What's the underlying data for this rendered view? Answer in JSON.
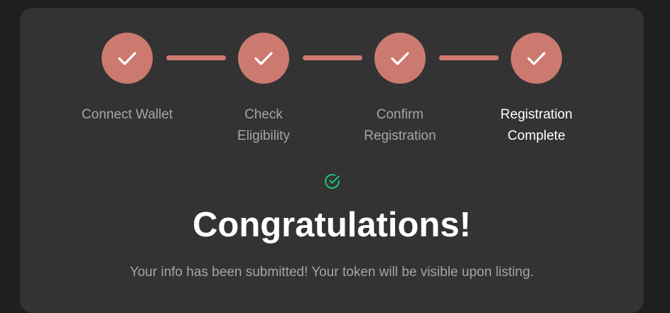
{
  "colors": {
    "page_background": "#1f1f1f",
    "card_background": "#333333",
    "step_complete": "#cc7a6f",
    "success_green": "#1fbf73",
    "text_muted": "#a5a5a5",
    "text_active": "#ffffff"
  },
  "steps": [
    {
      "label_line1": "Connect Wallet",
      "label_line2": "",
      "status": "complete",
      "icon": "check-icon"
    },
    {
      "label_line1": "Check",
      "label_line2": "Eligibility",
      "status": "complete",
      "icon": "check-icon"
    },
    {
      "label_line1": "Confirm",
      "label_line2": "Registration",
      "status": "complete",
      "icon": "check-icon"
    },
    {
      "label_line1": "Registration",
      "label_line2": "Complete",
      "status": "current",
      "icon": "check-icon"
    }
  ],
  "success": {
    "icon": "check-circle-icon",
    "title": "Congratulations!",
    "message": "Your info has been submitted! Your token will be visible upon listing."
  }
}
